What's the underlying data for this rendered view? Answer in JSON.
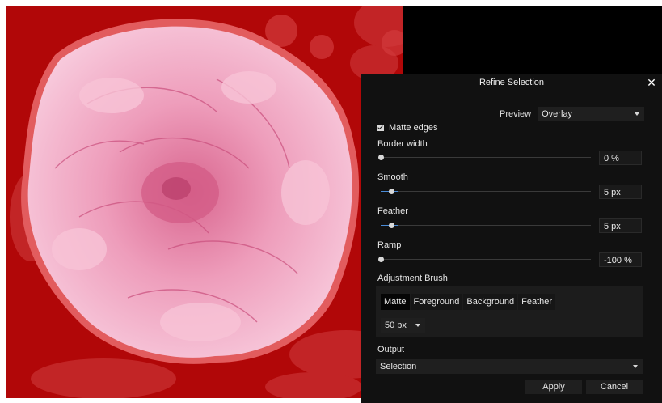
{
  "dialog": {
    "title": "Refine Selection",
    "close_glyph": "✕",
    "preview_label": "Preview",
    "preview_value": "Overlay",
    "matte_edges_label": "Matte edges",
    "matte_edges_checked": true,
    "border_width": {
      "label": "Border width",
      "value": "0 %",
      "level": 0.0
    },
    "smooth": {
      "label": "Smooth",
      "value": "5 px",
      "level": 0.05
    },
    "feather": {
      "label": "Feather",
      "value": "5 px",
      "level": 0.05
    },
    "ramp": {
      "label": "Ramp",
      "value": "-100 %",
      "level": 0.0
    },
    "adjustment_brush": {
      "label": "Adjustment Brush",
      "tabs": [
        "Matte",
        "Foreground",
        "Background",
        "Feather"
      ],
      "active_tab": "Matte",
      "size_value": "50 px"
    },
    "output_label": "Output",
    "output_value": "Selection",
    "apply_label": "Apply",
    "cancel_label": "Cancel"
  },
  "icons": {
    "close": "close-icon",
    "checkbox": "checkmark-icon",
    "dropdown": "chevron-down-icon"
  },
  "colors": {
    "overlay_red": "#b10708",
    "petal_pink": "#f2a8c4",
    "dialog_bg": "#111111",
    "slider_fill": "#4a8bd6"
  }
}
